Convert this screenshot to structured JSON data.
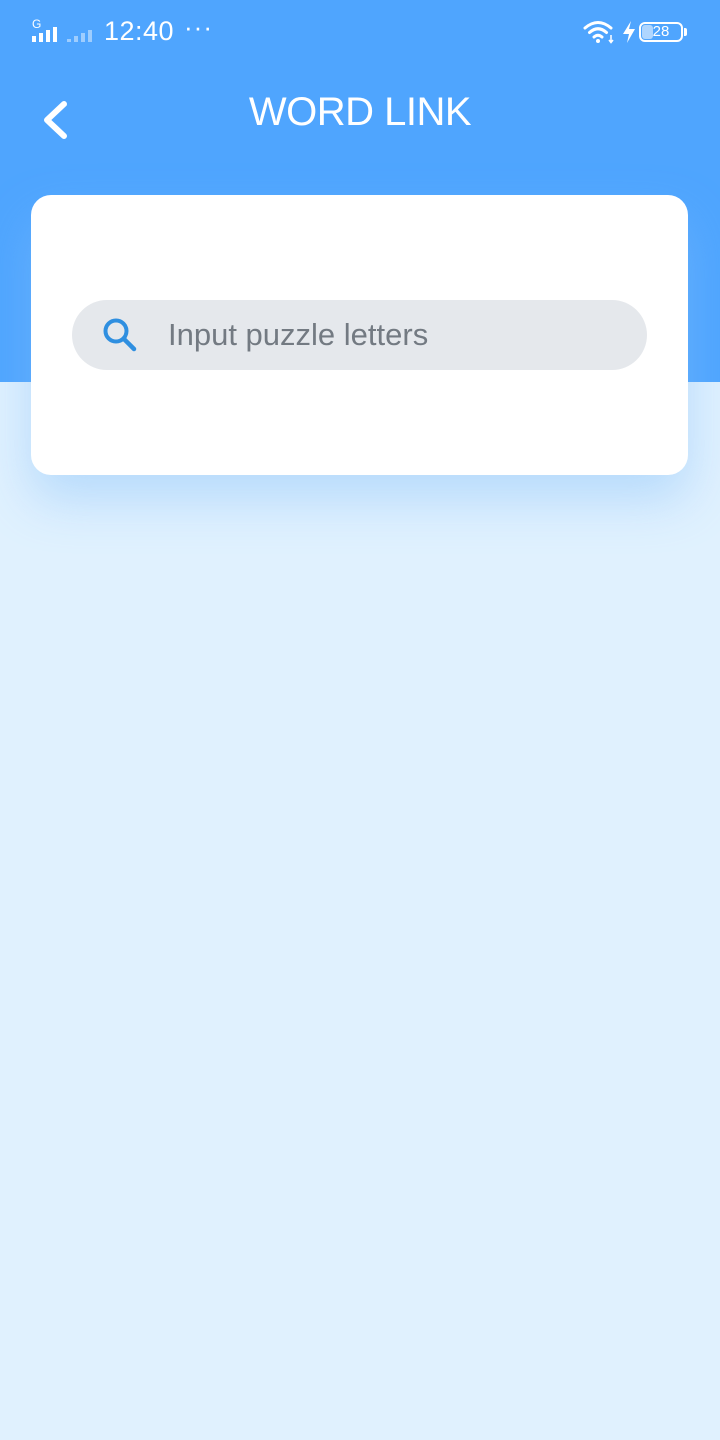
{
  "status_bar": {
    "network_label": "G",
    "time": "12:40",
    "more": "···",
    "battery_level": "28",
    "battery_fraction": 0.28
  },
  "header": {
    "title": "WORD LINK",
    "back_icon": "chevron-left-icon"
  },
  "search": {
    "placeholder": "Input puzzle letters",
    "icon": "search-icon"
  },
  "colors": {
    "header_blue": "#4fa5fe",
    "background_light_blue": "#e0f1fe",
    "card_white": "#ffffff",
    "search_field_gray": "#e5e8ec",
    "search_icon_blue": "#2f8fe0"
  }
}
